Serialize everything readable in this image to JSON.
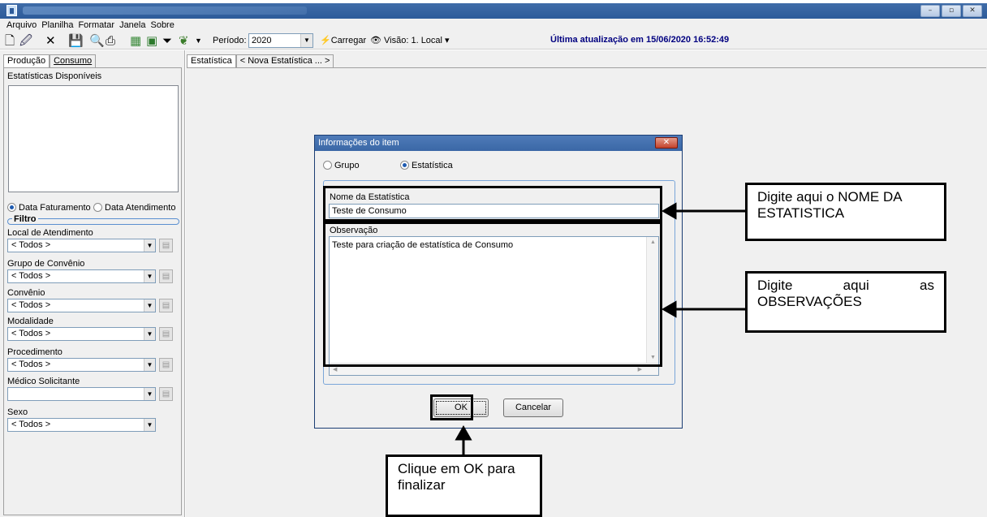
{
  "window": {
    "controls": [
      "–",
      "▫",
      "✕"
    ]
  },
  "menu": {
    "items": [
      "Arquivo",
      "Planilha",
      "Formatar",
      "Janela",
      "Sobre"
    ]
  },
  "toolbar": {
    "periodo_label": "Período:",
    "periodo_value": "2020",
    "carregar_label": "Carregar",
    "visao_label": "Visão: 1. Local",
    "ultima_atualizacao": "Última atualização em 15/06/2020 16:52:49"
  },
  "left": {
    "tabs": [
      "Produção",
      "Consumo"
    ],
    "estatisticas_label": "Estatísticas Disponíveis",
    "radio_faturamento": "Data Faturamento",
    "radio_atendimento": "Data Atendimento",
    "filtro_label": "Filtro",
    "filters": [
      {
        "label": "Local de Atendimento",
        "value": "< Todos >"
      },
      {
        "label": "Grupo de Convênio",
        "value": "< Todos >"
      },
      {
        "label": "Convênio",
        "value": "< Todos >"
      },
      {
        "label": "Modalidade",
        "value": "< Todos >"
      },
      {
        "label": "Procedimento",
        "value": "< Todos >"
      },
      {
        "label": "Médico Solicitante",
        "value": ""
      },
      {
        "label": "Sexo",
        "value": "< Todos >"
      }
    ]
  },
  "main": {
    "tabs": [
      "Estatística",
      "< Nova Estatística ... >"
    ]
  },
  "dialog": {
    "title": "Informações do item",
    "radio_grupo": "Grupo",
    "radio_estatistica": "Estatística",
    "nome_label": "Nome da Estatística",
    "nome_value": "Teste de Consumo",
    "obs_label": "Observação",
    "obs_value": "Teste para criação de estatística de Consumo",
    "ok_label": "OK",
    "cancel_label": "Cancelar"
  },
  "annotations": {
    "nome": "Digite aqui o NOME DA ESTATISTICA",
    "obs": "Digite aqui as OBSERVAÇÕES",
    "ok": "Clique em OK para finalizar"
  }
}
